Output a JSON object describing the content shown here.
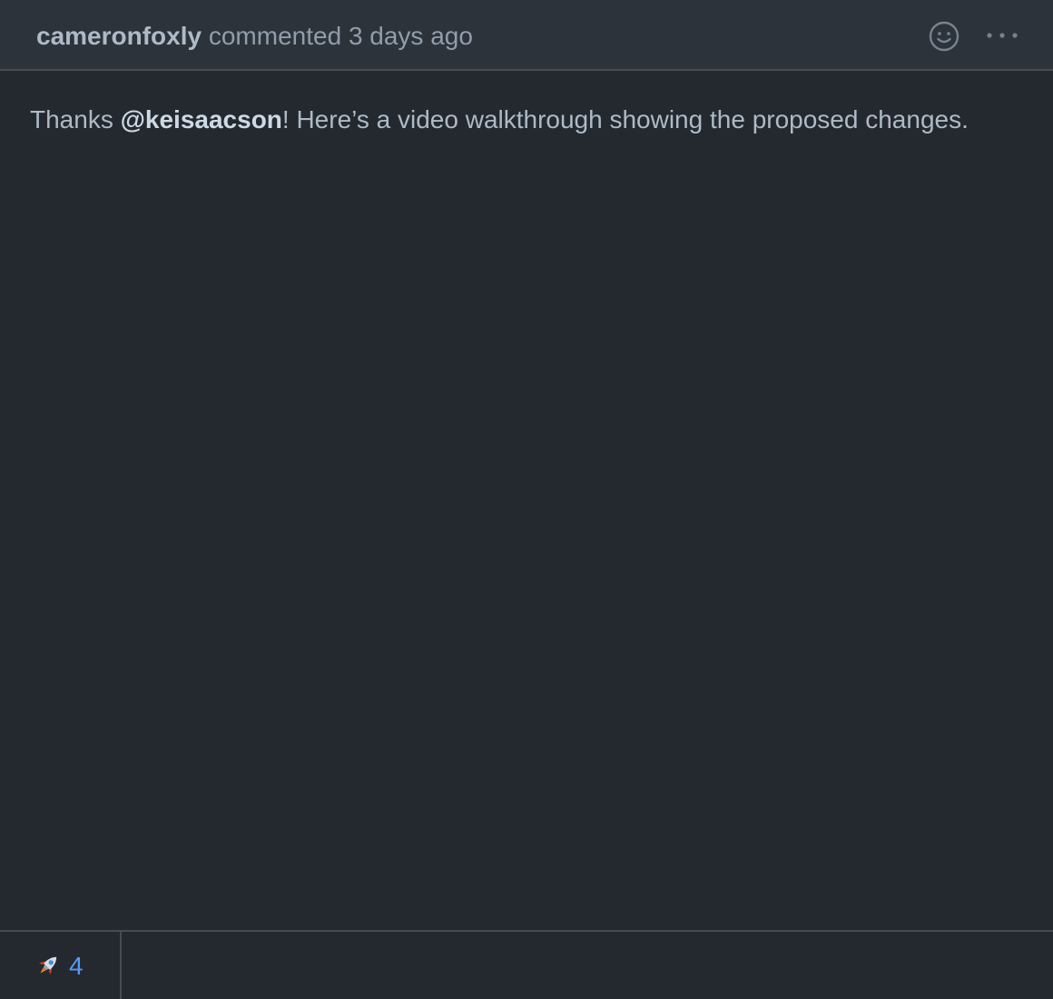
{
  "comment": {
    "author": "cameronfoxly",
    "action": "commented",
    "timestamp": "3 days ago",
    "body": {
      "prefix": "Thanks ",
      "mention": "@keisaacson",
      "suffix": "! Here’s a video walkthrough showing the proposed changes."
    }
  },
  "header_actions": {
    "emoji_icon": "smiley-icon",
    "more_icon": "kebab-horizontal-icon"
  },
  "reactions": [
    {
      "emoji": "rocket",
      "count": "4"
    }
  ],
  "colors": {
    "background": "#24292f",
    "header_background": "#2d333b",
    "border": "#444c56",
    "text": "#adbac7",
    "muted_text": "#909dab",
    "link": "#539bf5"
  }
}
